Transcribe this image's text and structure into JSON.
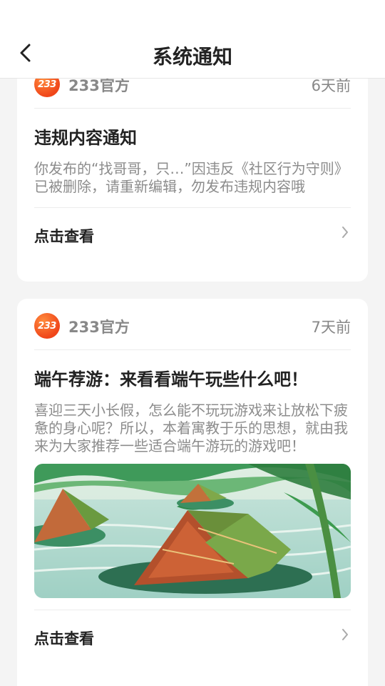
{
  "header": {
    "title": "系统通知"
  },
  "notifications": [
    {
      "logo_text": "233",
      "source": "233官方",
      "time": "6天前",
      "title": "违规内容通知",
      "body": "你发布的“找哥哥，只…”因违反《社区行为守则》已被删除，请重新编辑，勿发布违规内容哦",
      "action_label": "点击查看"
    },
    {
      "logo_text": "233",
      "source": "233官方",
      "time": "7天前",
      "title": "端午荐游：来看看端午玩些什么吧！",
      "body": "喜迎三天小长假，怎么能不玩玩游戏来让放松下疲惫的身心呢？所以，本着寓教于乐的思想，就由我来为大家推荐一些适合端午游玩的游戏吧！",
      "action_label": "点击查看"
    }
  ],
  "icons": {
    "back": "chevron-left-icon",
    "arrow": "chevron-right-icon"
  },
  "colors": {
    "brand": "#f0461a",
    "muted_text": "#888888",
    "background": "#f4f4f4"
  }
}
